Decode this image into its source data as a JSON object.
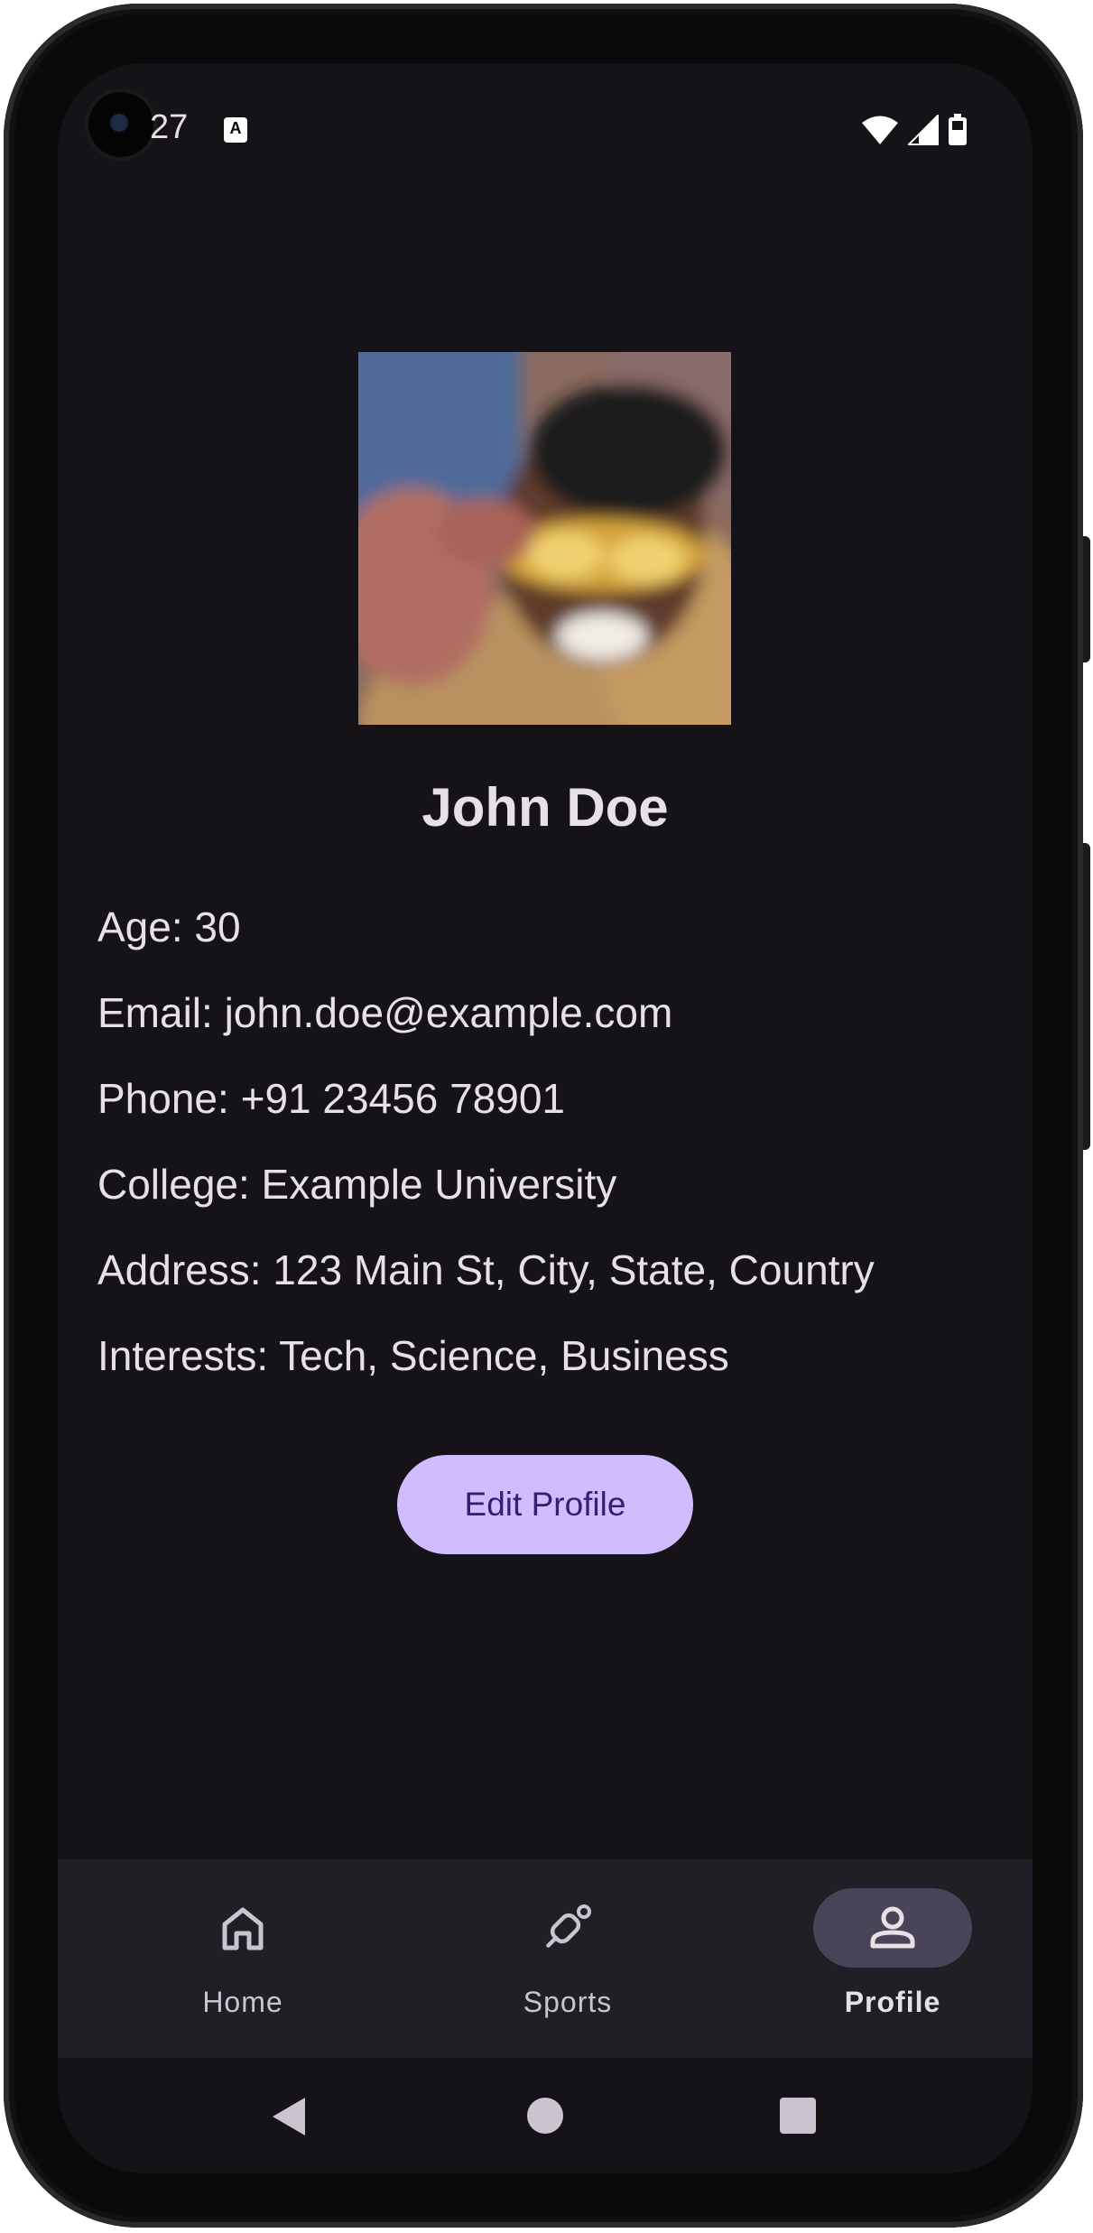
{
  "status_bar": {
    "time": "27",
    "notification_icon": "A"
  },
  "profile": {
    "name": "John Doe",
    "details": [
      "Age: 30",
      "Email: john.doe@example.com",
      "Phone: +91 23456 78901",
      "College: Example University",
      "Address: 123 Main St, City, State, Country",
      "Interests: Tech, Science, Business"
    ],
    "edit_button": "Edit Profile"
  },
  "bottom_nav": {
    "items": [
      {
        "label": "Home",
        "icon": "home-icon",
        "active": false
      },
      {
        "label": "Sports",
        "icon": "sports-icon",
        "active": false
      },
      {
        "label": "Profile",
        "icon": "person-icon",
        "active": true
      }
    ]
  },
  "colors": {
    "background": "#151218",
    "text": "#e6e1e5",
    "accent": "#d0bcff",
    "on_accent": "#381e72",
    "nav_background": "#211f26",
    "nav_indicator": "#4a4458"
  }
}
